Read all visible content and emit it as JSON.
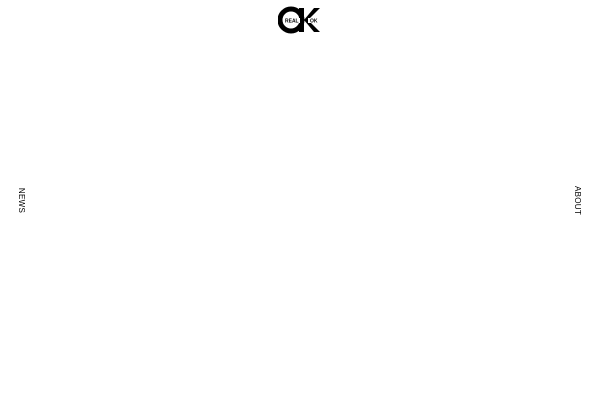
{
  "brand": {
    "logo_icon": "ok-monogram-icon",
    "logo_left_text": "REAL",
    "logo_right_text": "OK",
    "color": "#000000"
  },
  "nav": {
    "left_label": "NEWS",
    "right_label": "ABOUT"
  },
  "colors": {
    "background": "#ffffff",
    "foreground": "#000000"
  }
}
